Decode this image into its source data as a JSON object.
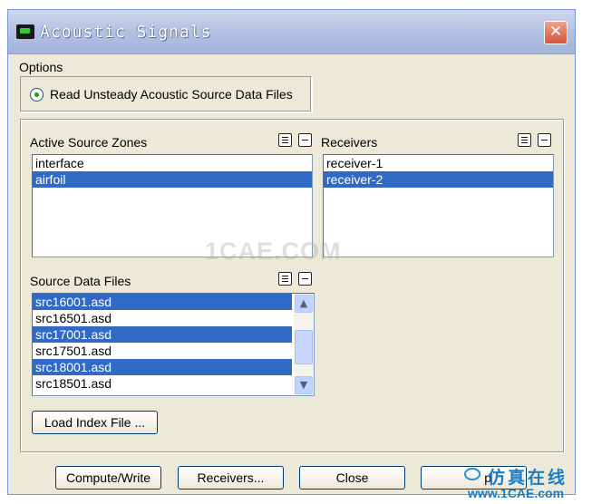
{
  "window": {
    "title": "Acoustic Signals",
    "close_glyph": "✕"
  },
  "options": {
    "label": "Options",
    "radio_label": "Read Unsteady Acoustic Source Data Files",
    "radio_selected": true
  },
  "active_source_zones": {
    "label": "Active Source Zones",
    "items": [
      {
        "text": "interface",
        "selected": false
      },
      {
        "text": "airfoil",
        "selected": true
      }
    ]
  },
  "receivers": {
    "label": "Receivers",
    "items": [
      {
        "text": "receiver-1",
        "selected": false
      },
      {
        "text": "receiver-2",
        "selected": true
      }
    ]
  },
  "source_data_files": {
    "label": "Source Data Files",
    "items": [
      {
        "text": "src16001.asd",
        "selected": true
      },
      {
        "text": "src16501.asd",
        "selected": false
      },
      {
        "text": "src17001.asd",
        "selected": true
      },
      {
        "text": "src17501.asd",
        "selected": false
      },
      {
        "text": "src18001.asd",
        "selected": true
      },
      {
        "text": "src18501.asd",
        "selected": false
      }
    ]
  },
  "buttons": {
    "load_index": "Load Index File ...",
    "compute_write": "Compute/Write",
    "receivers": "Receivers...",
    "close": "Close",
    "help_partial": "p"
  },
  "watermark": "1CAE.COM",
  "brand": {
    "cn": "仿真在线",
    "url": "www.1CAE.com"
  },
  "colors": {
    "selection": "#316ac5",
    "dialog_bg": "#ece9d8",
    "accent": "#1c7ec2"
  }
}
